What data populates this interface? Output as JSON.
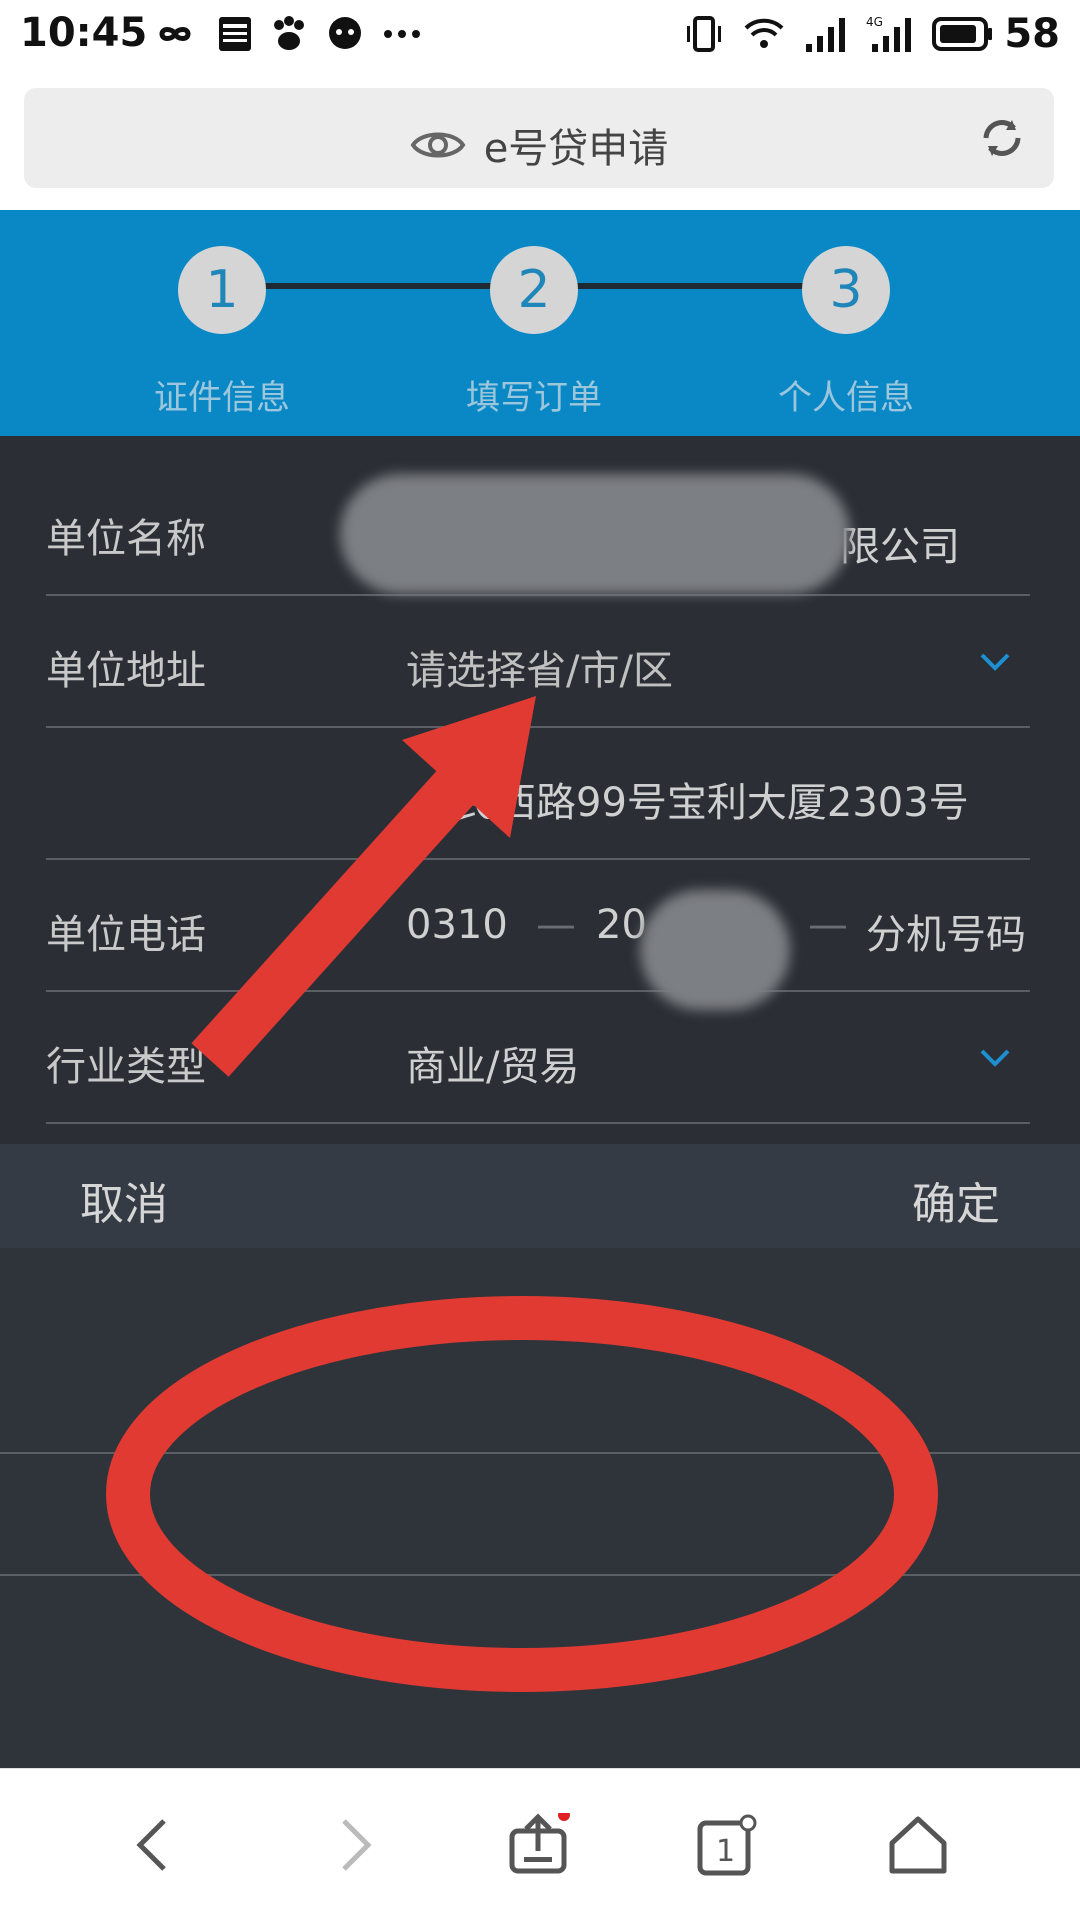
{
  "status_bar": {
    "time": "10:45",
    "battery": "58",
    "icons": [
      "infinity-icon",
      "news-icon",
      "baidu-paw-icon",
      "chat-icon",
      "more-dots-icon",
      "vibrate-icon",
      "wifi-icon",
      "signal-icon",
      "4g-signal-icon",
      "battery-icon"
    ]
  },
  "browser": {
    "title": "e号贷申请"
  },
  "steps": [
    {
      "number": "1",
      "label": "证件信息"
    },
    {
      "number": "2",
      "label": "填写订单"
    },
    {
      "number": "3",
      "label": "个人信息"
    }
  ],
  "form": {
    "unit_name": {
      "label": "单位名称",
      "value": "限公司"
    },
    "unit_address": {
      "label": "单位地址",
      "placeholder": "请选择省/市/区"
    },
    "address_detail": {
      "value": "长民西路99号宝利大厦2303号"
    },
    "unit_phone": {
      "label": "单位电话",
      "area": "0310",
      "number": "20",
      "extension_placeholder": "分机号码",
      "separator": "—"
    },
    "industry": {
      "label": "行业类型",
      "value": "商业/贸易"
    }
  },
  "picker": {
    "cancel_label": "取消",
    "confirm_label": "确定"
  },
  "colors": {
    "accent": "#0a88c6",
    "form_bg": "#2b2f35",
    "annotation_red": "#e03a32"
  }
}
